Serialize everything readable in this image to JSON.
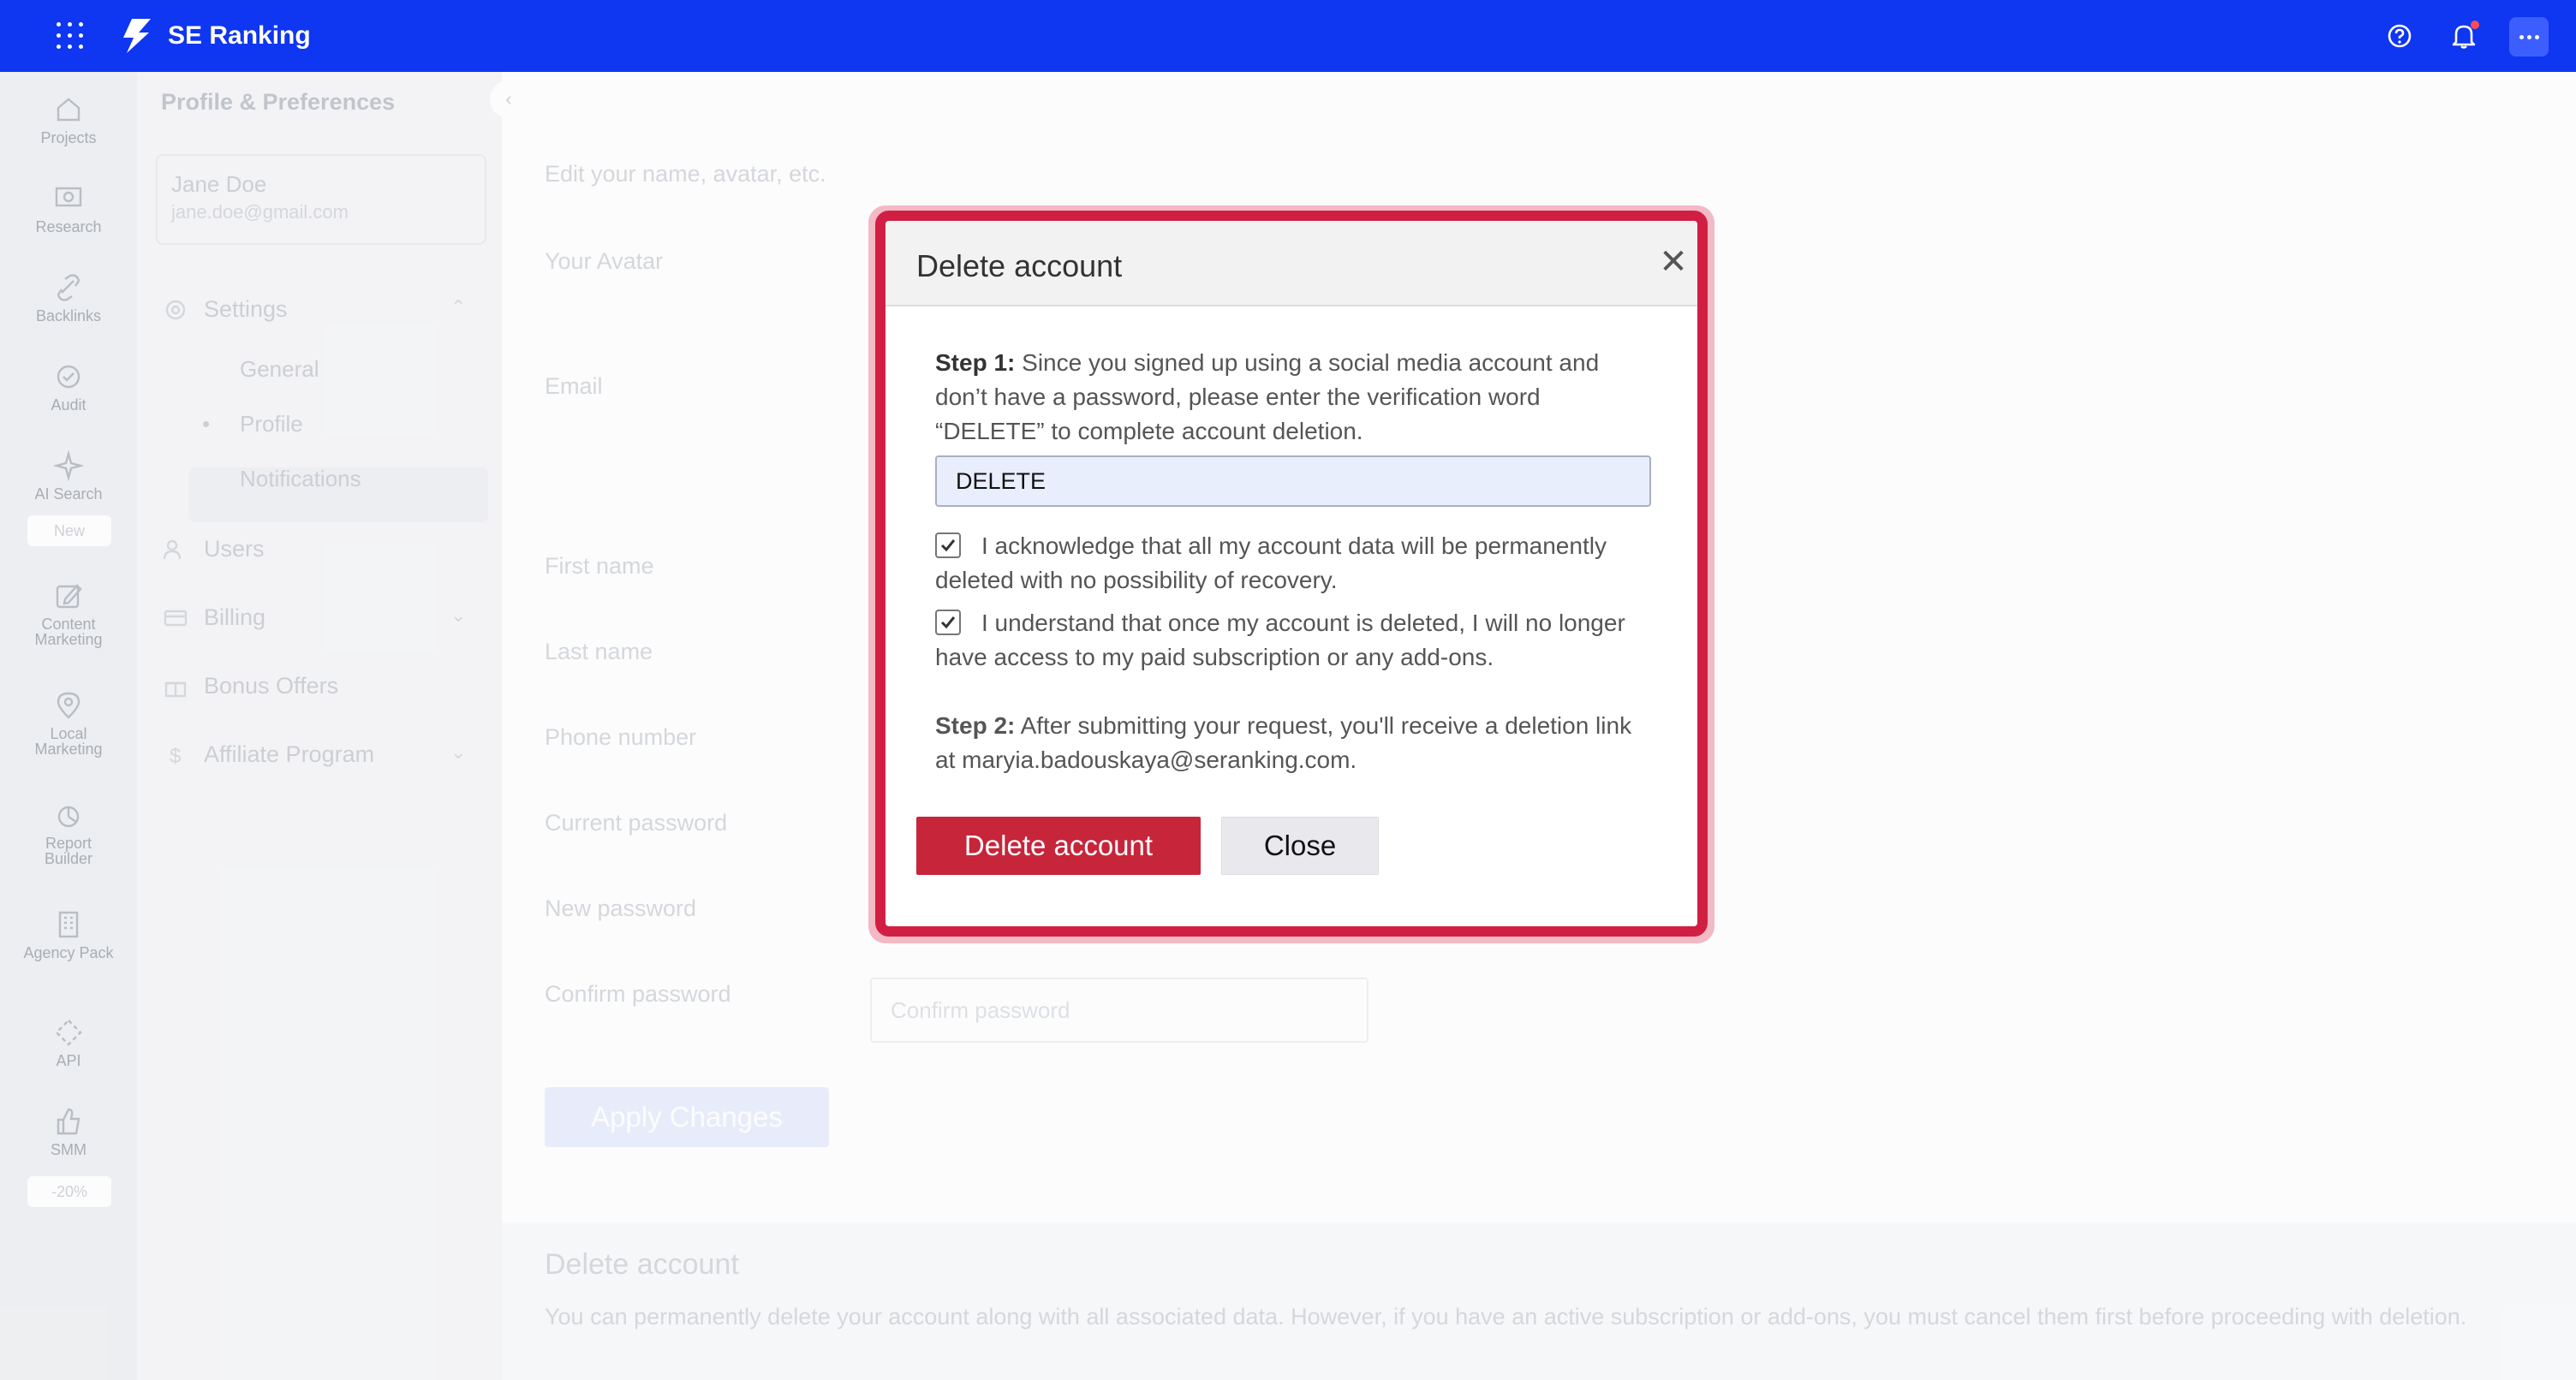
{
  "app": {
    "name": "SE Ranking"
  },
  "colors": {
    "brand": "#0f36f0",
    "danger": "#c6253a",
    "modal_border": "#d11f44"
  },
  "rail": {
    "items": [
      {
        "label": "Projects",
        "icon": "home-icon"
      },
      {
        "label": "Research",
        "icon": "research-icon"
      },
      {
        "label": "Backlinks",
        "icon": "link-icon"
      },
      {
        "label": "Audit",
        "icon": "audit-icon"
      },
      {
        "label": "AI Search",
        "icon": "sparkle-icon"
      },
      {
        "label": "Content Marketing",
        "icon": "edit-icon"
      },
      {
        "label": "Local Marketing",
        "icon": "pin-icon"
      },
      {
        "label": "Report Builder",
        "icon": "chart-icon"
      },
      {
        "label": "Agency Pack",
        "icon": "building-icon"
      },
      {
        "label": "API",
        "icon": "api-icon"
      },
      {
        "label": "SMM",
        "icon": "thumbs-up-icon"
      }
    ],
    "ai_badge": "New",
    "smm_badge": "-20%"
  },
  "sidebar": {
    "title": "Profile & Preferences",
    "user_name": "Jane Doe",
    "user_email": "jane.doe@gmail.com",
    "settings": "Settings",
    "general": "General",
    "profile": "Profile",
    "notifications": "Notifications",
    "users": "Users",
    "billing": "Billing",
    "bonus": "Bonus Offers",
    "affiliate": "Affiliate Program"
  },
  "main": {
    "subtitle": "Edit your name, avatar, etc.",
    "avatar_label": "Your Avatar",
    "email_label": "Email",
    "first_name_label": "First name",
    "last_name_label": "Last name",
    "phone_label": "Phone number",
    "current_password_label": "Current password",
    "new_password_label": "New password",
    "confirm_password_label": "Confirm password",
    "confirm_password_placeholder": "Confirm password",
    "apply_button": "Apply Changes",
    "delete_title": "Delete account",
    "delete_text": "You can permanently delete your account along with all associated data. However, if you have an active subscription or add-ons, you must cancel them first before proceeding with deletion."
  },
  "modal": {
    "title": "Delete account",
    "step1_label": "Step 1:",
    "step1_text": " Since you signed up using a social media account and don’t have a password, please enter the verification word “DELETE” to complete account deletion.",
    "input_value": "DELETE",
    "check1": "I acknowledge that all my account data will be permanently deleted with no possibility of recovery.",
    "check2": "I understand that once my account is deleted, I will no longer have access to my paid subscription or any add-ons.",
    "check1_checked": true,
    "check2_checked": true,
    "step2_label": "Step 2:",
    "step2_text": " After submitting your request, you'll receive a deletion link at maryia.badouskaya@seranking.com.",
    "delete_button": "Delete account",
    "close_button": "Close"
  }
}
